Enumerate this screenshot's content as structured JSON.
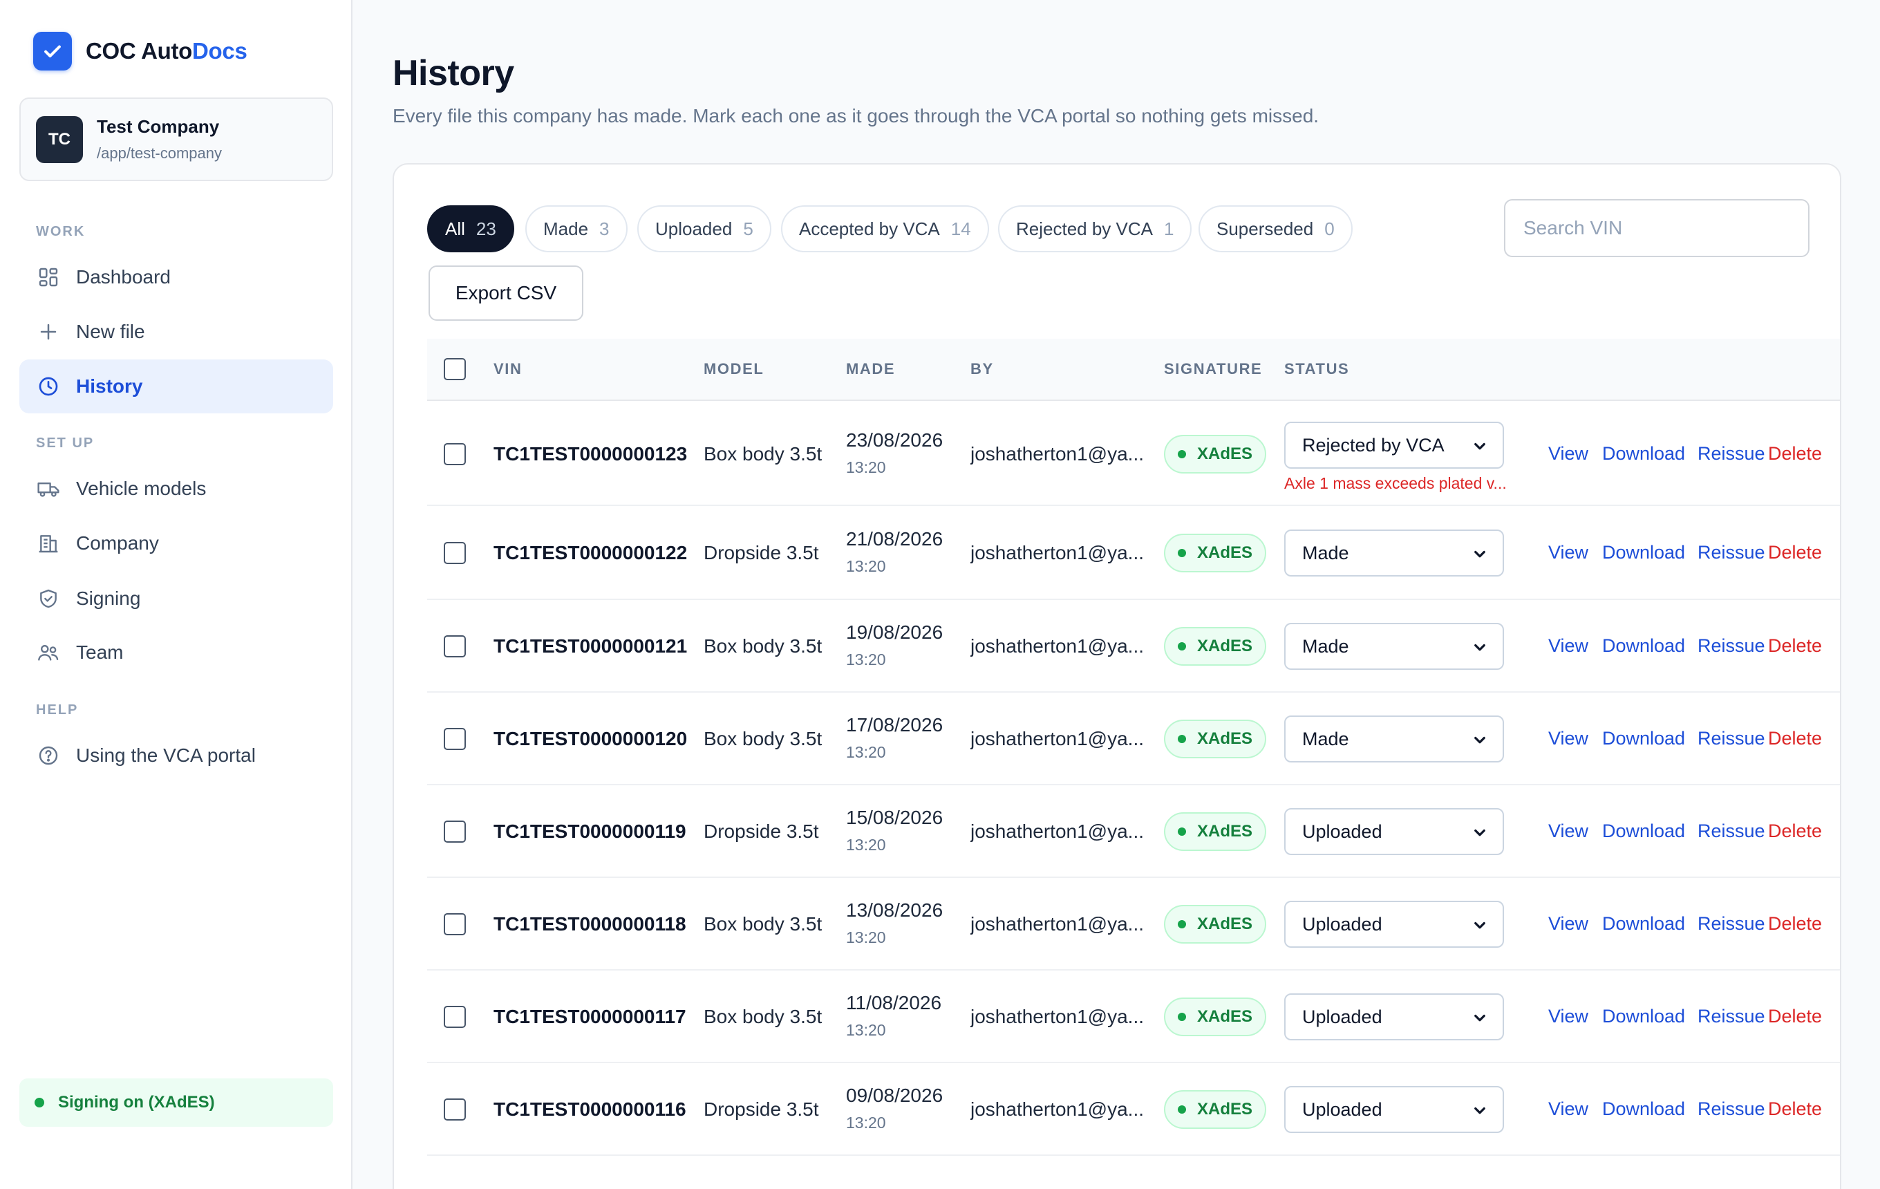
{
  "brand": {
    "name_prefix": "COC Auto",
    "name_accent": "Docs"
  },
  "company": {
    "initials": "TC",
    "name": "Test Company",
    "path": "/app/test-company"
  },
  "nav": {
    "section_work": "WORK",
    "section_setup": "SET UP",
    "section_help": "HELP",
    "dashboard": "Dashboard",
    "new_file": "New file",
    "history": "History",
    "vehicle_models": "Vehicle models",
    "company": "Company",
    "signing": "Signing",
    "team": "Team",
    "vca_portal": "Using the VCA portal"
  },
  "signing_status": "Signing on (XAdES)",
  "page": {
    "title": "History",
    "subtitle": "Every file this company has made. Mark each one as it goes through the VCA portal so nothing gets missed."
  },
  "tabs": [
    {
      "label": "All",
      "count": "23"
    },
    {
      "label": "Made",
      "count": "3"
    },
    {
      "label": "Uploaded",
      "count": "5"
    },
    {
      "label": "Accepted by VCA",
      "count": "14"
    },
    {
      "label": "Rejected by VCA",
      "count": "1"
    },
    {
      "label": "Superseded",
      "count": "0"
    }
  ],
  "search": {
    "placeholder": "Search VIN"
  },
  "export_label": "Export CSV",
  "table": {
    "headers": {
      "vin": "VIN",
      "model": "MODEL",
      "made": "MADE",
      "by": "BY",
      "signature": "SIGNATURE",
      "status": "STATUS"
    },
    "actions": {
      "view": "View",
      "download": "Download",
      "reissue": "Reissue",
      "delete": "Delete"
    },
    "rows": [
      {
        "vin": "TC1TEST0000000123",
        "model": "Box body 3.5t",
        "date": "23/08/2026",
        "time": "13:20",
        "by": "joshatherton1@ya...",
        "signature": "XAdES",
        "status": "Rejected by VCA",
        "note": "Axle 1 mass exceeds plated v..."
      },
      {
        "vin": "TC1TEST0000000122",
        "model": "Dropside 3.5t",
        "date": "21/08/2026",
        "time": "13:20",
        "by": "joshatherton1@ya...",
        "signature": "XAdES",
        "status": "Made"
      },
      {
        "vin": "TC1TEST0000000121",
        "model": "Box body 3.5t",
        "date": "19/08/2026",
        "time": "13:20",
        "by": "joshatherton1@ya...",
        "signature": "XAdES",
        "status": "Made"
      },
      {
        "vin": "TC1TEST0000000120",
        "model": "Box body 3.5t",
        "date": "17/08/2026",
        "time": "13:20",
        "by": "joshatherton1@ya...",
        "signature": "XAdES",
        "status": "Made"
      },
      {
        "vin": "TC1TEST0000000119",
        "model": "Dropside 3.5t",
        "date": "15/08/2026",
        "time": "13:20",
        "by": "joshatherton1@ya...",
        "signature": "XAdES",
        "status": "Uploaded"
      },
      {
        "vin": "TC1TEST0000000118",
        "model": "Box body 3.5t",
        "date": "13/08/2026",
        "time": "13:20",
        "by": "joshatherton1@ya...",
        "signature": "XAdES",
        "status": "Uploaded"
      },
      {
        "vin": "TC1TEST0000000117",
        "model": "Box body 3.5t",
        "date": "11/08/2026",
        "time": "13:20",
        "by": "joshatherton1@ya...",
        "signature": "XAdES",
        "status": "Uploaded"
      },
      {
        "vin": "TC1TEST0000000116",
        "model": "Dropside 3.5t",
        "date": "09/08/2026",
        "time": "13:20",
        "by": "joshatherton1@ya...",
        "signature": "XAdES",
        "status": "Uploaded"
      }
    ]
  },
  "colors": {
    "accent": "#2563eb",
    "danger": "#dc2626",
    "success": "#16a34a",
    "dark": "#0f172a"
  }
}
